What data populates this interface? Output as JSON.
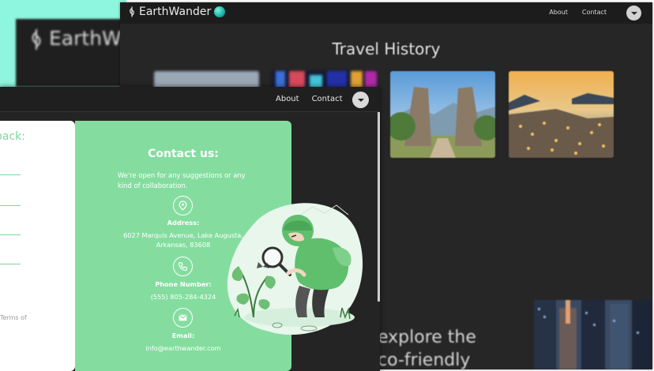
{
  "back_window": {
    "brand": "EarthW"
  },
  "travel_window": {
    "brand": "EarthWander",
    "nav": {
      "about": "About",
      "contact": "Contact"
    },
    "title": "Travel History",
    "photos": [
      {
        "name": "blurred-landscape"
      },
      {
        "name": "neon-city-night"
      },
      {
        "name": "bali-temple-gate"
      },
      {
        "name": "coastal-town-sunset"
      }
    ],
    "explore": {
      "line1": "explore the",
      "line2": "co-friendly"
    }
  },
  "contact_window": {
    "nav": {
      "about": "About",
      "contact": "Contact"
    },
    "form": {
      "heading": "back:",
      "terms": "Terms of"
    },
    "card": {
      "title": "Contact us:",
      "intro": "We're open for any suggestions or any kind of collaboration.",
      "address_label": "Address:",
      "address_line1": "6027 Marquis Avenue, Lake Augusta,",
      "address_line2": "Arkansas, 83608",
      "phone_label": "Phone Number:",
      "phone": "(555) 805-284-4324",
      "email_label": "Email:",
      "email": "info@earthwander.com"
    }
  },
  "colors": {
    "accent_green": "#84dd9f",
    "mint": "#8ef5de",
    "dark_bg": "#242424"
  },
  "icons": [
    "location-pin-icon",
    "phone-icon",
    "mail-icon",
    "chevron-down-icon",
    "earthwander-logo-icon",
    "globe-icon"
  ]
}
